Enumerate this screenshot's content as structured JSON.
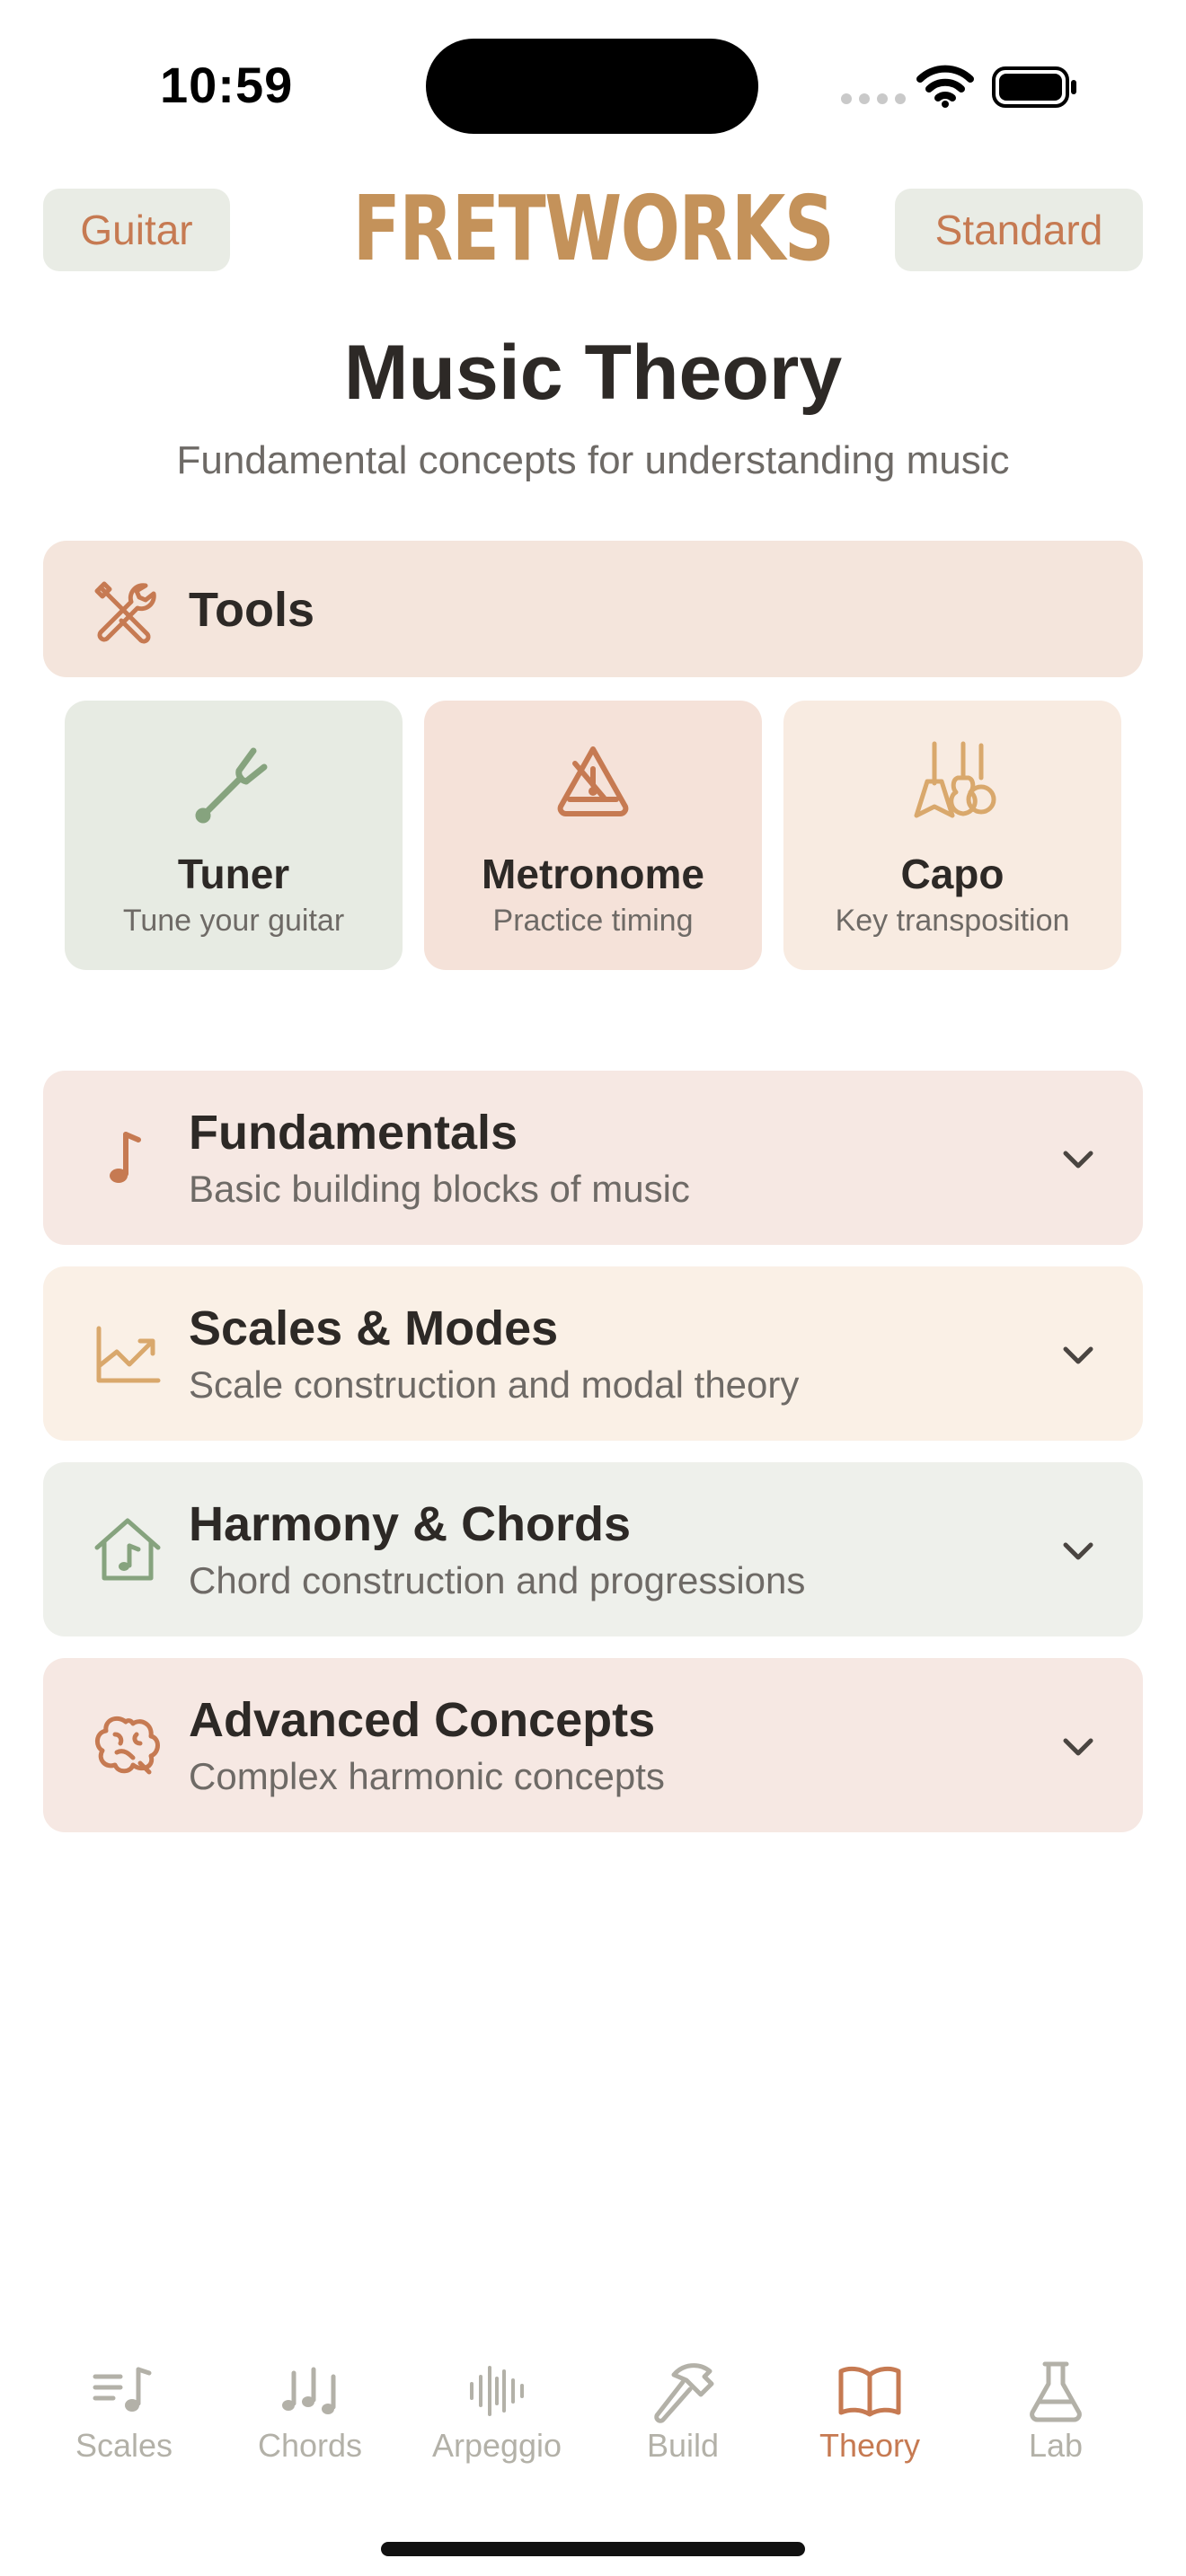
{
  "status": {
    "time": "10:59"
  },
  "header": {
    "left_pill": "Guitar",
    "logo": "FRETWORKS",
    "right_pill": "Standard"
  },
  "page": {
    "title": "Music Theory",
    "subtitle": "Fundamental concepts for understanding music"
  },
  "tools": {
    "label": "Tools",
    "items": [
      {
        "title": "Tuner",
        "subtitle": "Tune your guitar",
        "icon": "tuning-fork-icon"
      },
      {
        "title": "Metronome",
        "subtitle": "Practice timing",
        "icon": "metronome-icon"
      },
      {
        "title": "Capo",
        "subtitle": "Key transposition",
        "icon": "guitars-icon"
      }
    ]
  },
  "sections": [
    {
      "title": "Fundamentals",
      "subtitle": "Basic building blocks of music",
      "icon": "music-note-icon"
    },
    {
      "title": "Scales & Modes",
      "subtitle": "Scale construction and modal theory",
      "icon": "chart-line-icon"
    },
    {
      "title": "Harmony & Chords",
      "subtitle": "Chord construction and progressions",
      "icon": "music-house-icon"
    },
    {
      "title": "Advanced Concepts",
      "subtitle": "Complex harmonic concepts",
      "icon": "brain-icon"
    }
  ],
  "tab_bar": {
    "active": "Theory",
    "tabs": [
      {
        "label": "Scales",
        "icon": "scales-icon"
      },
      {
        "label": "Chords",
        "icon": "notes-icon"
      },
      {
        "label": "Arpeggio",
        "icon": "waveform-icon"
      },
      {
        "label": "Build",
        "icon": "hammer-icon"
      },
      {
        "label": "Theory",
        "icon": "book-icon"
      },
      {
        "label": "Lab",
        "icon": "flask-icon"
      }
    ]
  },
  "colors": {
    "accent": "#c67a52",
    "logo": "#c4925a",
    "inactive_tab": "#b3b1a8"
  }
}
